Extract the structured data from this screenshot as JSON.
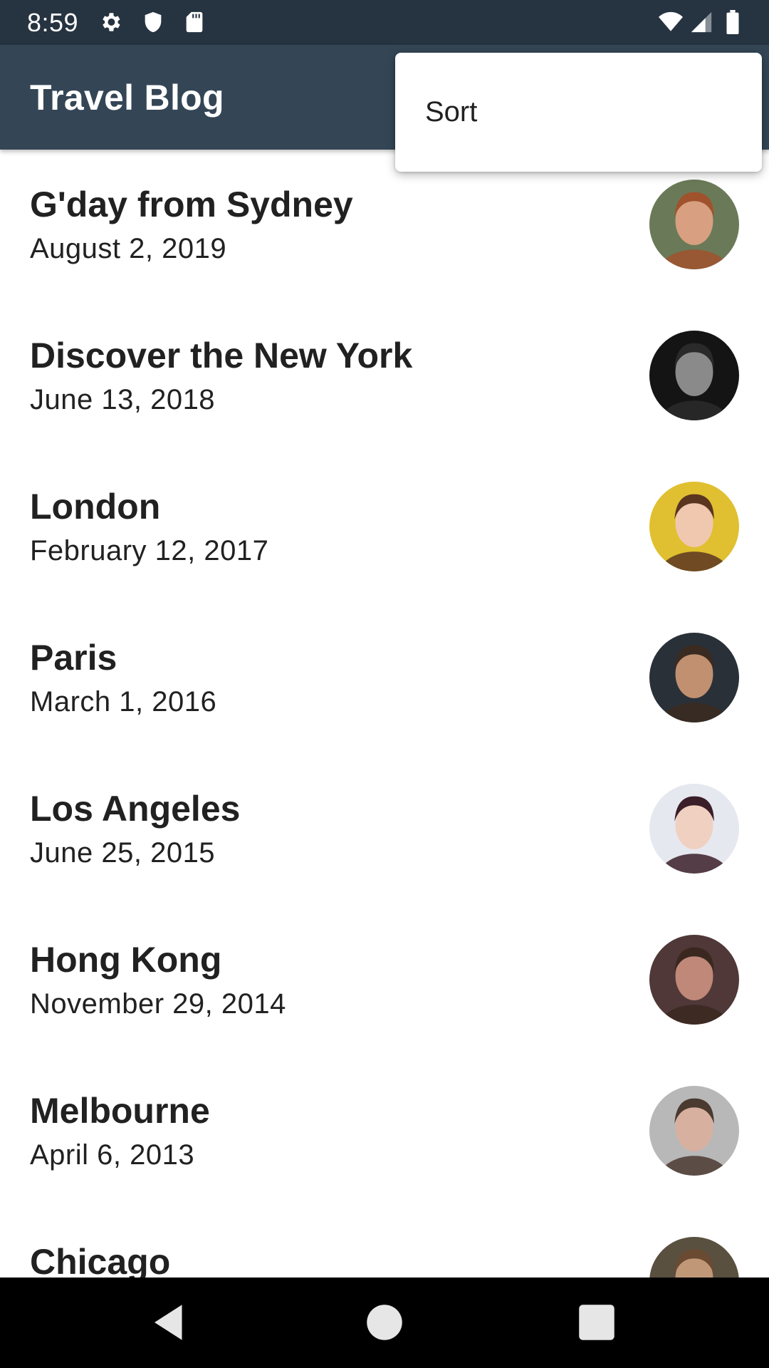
{
  "status_bar": {
    "time": "8:59",
    "left_icons": [
      "gear-icon",
      "shield-icon",
      "sd-card-icon"
    ],
    "right_icons": [
      "wifi-icon",
      "signal-icon",
      "battery-icon"
    ]
  },
  "app_bar": {
    "title": "Travel Blog",
    "color": "#344656"
  },
  "popup_menu": {
    "items": [
      {
        "label": "Sort"
      }
    ]
  },
  "posts": [
    {
      "title": "G'day from Sydney",
      "date": "August 2, 2019",
      "avatar": {
        "bg": "#6a7a58",
        "skin": "#d8a080",
        "hair": "#a0522d"
      }
    },
    {
      "title": "Discover the New York",
      "date": "June 13, 2018",
      "avatar": {
        "bg": "#141414",
        "skin": "#8a8a8a",
        "hair": "#2a2a2a"
      }
    },
    {
      "title": "London",
      "date": "February 12, 2017",
      "avatar": {
        "bg": "#e0c030",
        "skin": "#f0c8b0",
        "hair": "#5a3520"
      }
    },
    {
      "title": "Paris",
      "date": "March 1, 2016",
      "avatar": {
        "bg": "#2a3038",
        "skin": "#c09070",
        "hair": "#3a2a20"
      }
    },
    {
      "title": "Los Angeles",
      "date": "June 25, 2015",
      "avatar": {
        "bg": "#e6e8f0",
        "skin": "#f0d0c0",
        "hair": "#3a1e28"
      }
    },
    {
      "title": "Hong Kong",
      "date": "November 29, 2014",
      "avatar": {
        "bg": "#503838",
        "skin": "#c08878",
        "hair": "#3a2820"
      }
    },
    {
      "title": "Melbourne",
      "date": "April 6, 2013",
      "avatar": {
        "bg": "#b8b8b8",
        "skin": "#d8b0a0",
        "hair": "#4a3a30"
      }
    },
    {
      "title": "Chicago",
      "date": "",
      "avatar": {
        "bg": "#5a5040",
        "skin": "#c09878",
        "hair": "#6a4a30"
      }
    }
  ],
  "nav_bar": {
    "buttons": [
      "back-icon",
      "home-icon",
      "recents-icon"
    ]
  }
}
